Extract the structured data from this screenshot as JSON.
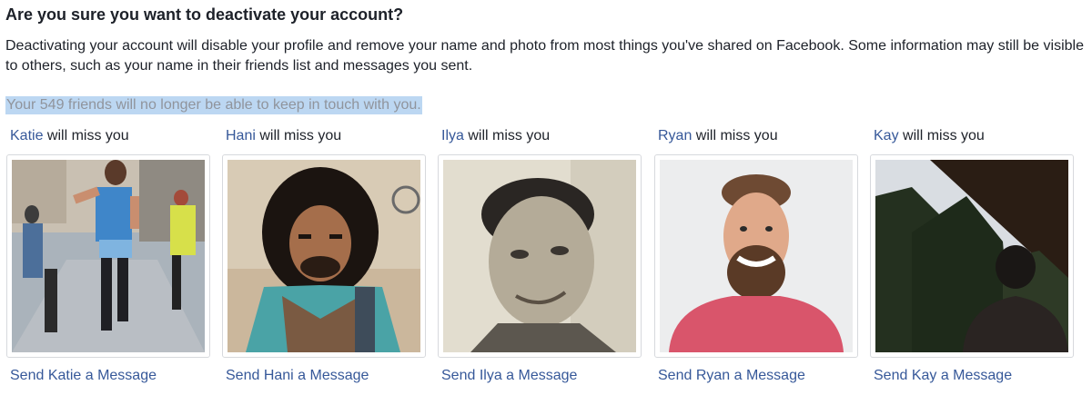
{
  "dialog": {
    "title": "Are you sure you want to deactivate your account?",
    "description": "Deactivating your account will disable your profile and remove your name and photo from most things you've shared on Facebook. Some information may still be visible to others, such as your name in their friends list and messages you sent.",
    "friends_note": "Your 549 friends will no longer be able to keep in touch with you."
  },
  "friends": [
    {
      "name": "Katie",
      "miss_suffix": " will miss you",
      "send_label": "Send Katie a Message"
    },
    {
      "name": "Hani",
      "miss_suffix": " will miss you",
      "send_label": "Send Hani a Message"
    },
    {
      "name": "Ilya",
      "miss_suffix": " will miss you",
      "send_label": "Send Ilya a Message"
    },
    {
      "name": "Ryan",
      "miss_suffix": " will miss you",
      "send_label": "Send Ryan a Message"
    },
    {
      "name": "Kay",
      "miss_suffix": " will miss you",
      "send_label": "Send Kay a Message"
    }
  ],
  "colors": {
    "link": "#365899",
    "text": "#1d2129",
    "muted": "#90949c",
    "highlight": "#bcd7f2"
  }
}
